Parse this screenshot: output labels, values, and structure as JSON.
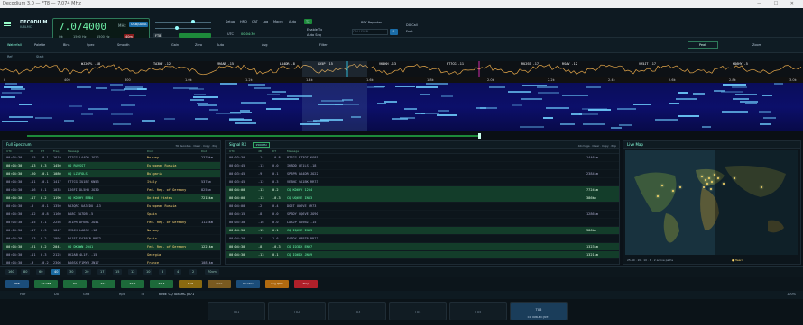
{
  "window": {
    "title": "Decodium 3.0 — FT8 — 7.074 MHz",
    "controls": "— ☐ ✕"
  },
  "brand": {
    "name": "DECODIUM",
    "call": "IU8LMC"
  },
  "rig": {
    "freq": "7.074000",
    "unit": "MHz",
    "mode_badge": "USB/DATA",
    "ok": "Ok",
    "split_label": "1500 Hz",
    "rx_label": "1500 Hz",
    "band": "40m",
    "power_label": "Pwr"
  },
  "controls": {
    "mode": "FT8",
    "tx_btn": "TX",
    "setup": "Setup",
    "hrd": "HRD",
    "cat": "CAT",
    "log": "Log",
    "macro": "Macro",
    "auto": "Auto",
    "tx_enable": "Enable Tx",
    "auto_seq": "Auto Seq",
    "call": "PSK Reporter",
    "search_placeholder": "CALLSIGN",
    "utc_label": "UTC",
    "utc_time": "00:04:30",
    "dx_label": "DX Call",
    "font_label": "Font"
  },
  "row2": {
    "left": "Waterfall",
    "palette": "Palette",
    "bins": "Bins",
    "spec_label": "Spec",
    "ref_label": "Ref",
    "start_label": "Start",
    "smooth": "Smooth",
    "gain": "Gain",
    "zero": "Zero",
    "auto_btn": "Auto",
    "avg": "Avg",
    "filter": "Filter",
    "freq_btn": "Peak",
    "zoom": "Zoom"
  },
  "spectrum_labels": [
    "WJ2CPL -18",
    "TA3NF -12",
    "YR6AB -15",
    "LA4DR -8",
    "UX5P -15",
    "VK5KH -13",
    "PT7CG -11",
    "RU2SS -17",
    "RSAV -12",
    "VR5JT -17",
    "KD6HY -5"
  ],
  "scale_ticks": [
    "0",
    "400",
    "800",
    "1.0k",
    "1.2k",
    "1.4k",
    "1.6k",
    "1.8k",
    "2.0k",
    "2.2k",
    "2.4k",
    "2.6k",
    "2.8k",
    "3.0k"
  ],
  "panes": {
    "full": {
      "title": "Full Spectrum",
      "actions": "76 decodes · Clear · Copy · Pop",
      "cols": [
        "UTC",
        "dB",
        "DT",
        "Freq",
        "Message",
        "Dxcc",
        "Dist"
      ]
    },
    "rx": {
      "title": "Signal RX",
      "badge": "1500 Hz",
      "actions": "44 msgs · Clear · Copy · Pop",
      "cols": [
        "UTC",
        "dB",
        "DT",
        "Message"
      ]
    },
    "map": {
      "title": "Live Map",
      "legend": "25-40 · 20 · 10 · 6 · 2 active paths",
      "legend2": "● Heard"
    }
  },
  "full_rows": [
    {
      "t": "00:04:30",
      "db": "-15",
      "dt": "-0.1",
      "f": "1619",
      "msg": "PT7CG LA4DR JO22",
      "dx": "Norway",
      "dist": "2379km",
      "cq": false
    },
    {
      "t": "00:04:30",
      "db": "-13",
      "dt": "0.3",
      "f": "1450",
      "msg": "CQ RU2SST",
      "dx": "European Russia",
      "dist": "",
      "cq": true
    },
    {
      "t": "00:04:30",
      "db": "-20",
      "dt": "-0.1",
      "f": "1080",
      "msg": "CQ LZ1FOLS",
      "dx": "Bulgaria",
      "dist": "",
      "cq": true
    },
    {
      "t": "00:04:30",
      "db": "-11",
      "dt": "-0.1",
      "f": "1417",
      "msg": "PT7CG IU1BZ KN53",
      "dx": "Italy",
      "dist": "537km",
      "cq": false
    },
    {
      "t": "00:04:30",
      "db": "-16",
      "dt": "0.1",
      "f": "1035",
      "msg": "DJ6FI DL5HB JO30",
      "dx": "Fed. Rep. of Germany",
      "dist": "825km",
      "cq": false
    },
    {
      "t": "00:04:30",
      "db": "-17",
      "dt": "0.2",
      "f": "1190",
      "msg": "CQ KD6HY EM84",
      "dx": "United States",
      "dist": "7215km",
      "cq": true
    },
    {
      "t": "00:04:30",
      "db": "-5",
      "dt": "-0.1",
      "f": "1350",
      "msg": "RA3QRC UA3EDU -13",
      "dx": "European Russia",
      "dist": "",
      "cq": false
    },
    {
      "t": "00:04:30",
      "db": "-12",
      "dt": "-0.8",
      "f": "1160",
      "msg": "EA8C EA7DB -5",
      "dx": "Spain",
      "dist": "",
      "cq": false
    },
    {
      "t": "00:04:30",
      "db": "-15",
      "dt": "0.1",
      "f": "2256",
      "msg": "IK1PR DF6NS JO41",
      "dx": "Fed. Rep. of Germany",
      "dist": "1123km",
      "cq": false
    },
    {
      "t": "00:04:30",
      "db": "-17",
      "dt": "0.3",
      "f": "1847",
      "msg": "SM5JH LA8SJ -18",
      "dx": "Norway",
      "dist": "",
      "cq": false
    },
    {
      "t": "00:04:30",
      "db": "-13",
      "dt": "0.2",
      "f": "1994",
      "msg": "EA1EI EA3BIR RR73",
      "dx": "Spain",
      "dist": "",
      "cq": false
    },
    {
      "t": "00:04:30",
      "db": "-21",
      "dt": "0.2",
      "f": "2041",
      "msg": "CQ DK3WN JO41",
      "dx": "Fed. Rep. of Germany",
      "dist": "1221km",
      "cq": true
    },
    {
      "t": "00:04:30",
      "db": "-11",
      "dt": "0.3",
      "f": "2125",
      "msg": "UK2AB 4L1FL -15",
      "dx": "Georgia",
      "dist": "",
      "cq": false
    },
    {
      "t": "00:04:30",
      "db": "-9",
      "dt": "-0.2",
      "f": "2306",
      "msg": "EA6SX F1MYH JN17",
      "dx": "France",
      "dist": "1081km",
      "cq": false
    }
  ],
  "rx_rows": [
    {
      "t": "00:03:30",
      "db": "-14",
      "dt": "-0.8",
      "msg": "PT7CG RZ3DT KO85",
      "dist": "1446km",
      "cq": false
    },
    {
      "t": "00:03:45",
      "db": "-13",
      "dt": "0.0",
      "msg": "IK8DD OE1LS -18",
      "dist": "",
      "cq": false
    },
    {
      "t": "00:03:45",
      "db": "-9",
      "dt": "0.1",
      "msg": "SP3PR LA4DR JO22",
      "dist": "2384km",
      "cq": false
    },
    {
      "t": "00:03:45",
      "db": "-12",
      "dt": "0.3",
      "msg": "VE3NC SA1BK RR73",
      "dist": "",
      "cq": false
    },
    {
      "t": "00:04:00",
      "db": "-13",
      "dt": "0.2",
      "msg": "CQ KD6HY 1234",
      "dist": "7724km",
      "cq": true
    },
    {
      "t": "00:04:00",
      "db": "-13",
      "dt": "-0.3",
      "msg": "CQ UQ6VE IN83",
      "dist": "386km",
      "cq": true
    },
    {
      "t": "00:04:00",
      "db": "-2",
      "dt": "0.4",
      "msg": "DG5T UQ6VE RR73",
      "dist": "",
      "cq": false
    },
    {
      "t": "00:04:15",
      "db": "-8",
      "dt": "0.0",
      "msg": "SP6DY UQ6VE JO90",
      "dist": "1286km",
      "cq": false
    },
    {
      "t": "00:04:30",
      "db": "-16",
      "dt": "0.0",
      "msg": "LA8JP UA9BZ -15",
      "dist": "",
      "cq": false
    },
    {
      "t": "00:04:30",
      "db": "-15",
      "dt": "0.1",
      "msg": "CQ IQ6VE IN83",
      "dist": "386km",
      "cq": true
    },
    {
      "t": "00:04:30",
      "db": "-11",
      "dt": "1.6",
      "msg": "EA6DX HB9TR RR73",
      "dist": "",
      "cq": false
    },
    {
      "t": "00:04:30",
      "db": "-8",
      "dt": "-0.3",
      "msg": "CQ IQ3DX EN97",
      "dist": "1323km",
      "cq": true
    },
    {
      "t": "00:04:30",
      "db": "-13",
      "dt": "0.1",
      "msg": "CQ IO6DX JN59",
      "dist": "1321km",
      "cq": true
    }
  ],
  "bands": [
    "160",
    "80",
    "60",
    "40",
    "30",
    "20",
    "17",
    "15",
    "12",
    "10",
    "6",
    "4",
    "2",
    "70cm"
  ],
  "bottom_buttons": [
    "FT8",
    "TX OFF",
    "RX",
    "TX 1",
    "TX 2",
    "TX 3",
    "Halt",
    "Tune",
    "Monitor",
    "Log QSO",
    "Stop"
  ],
  "bottom3": {
    "hdr": "Hdr",
    "dx": "DX",
    "grid": "Grid",
    "rpt": "Rpt",
    "tx": "Tx",
    "msg": "Next: CQ IU8LMC JN71",
    "zoom": "100%"
  },
  "tx_boxes": [
    "TX1",
    "TX2",
    "TX3",
    "TX4",
    "TX5",
    "TX6"
  ],
  "tx_active": "CQ IU8LMC JN71"
}
